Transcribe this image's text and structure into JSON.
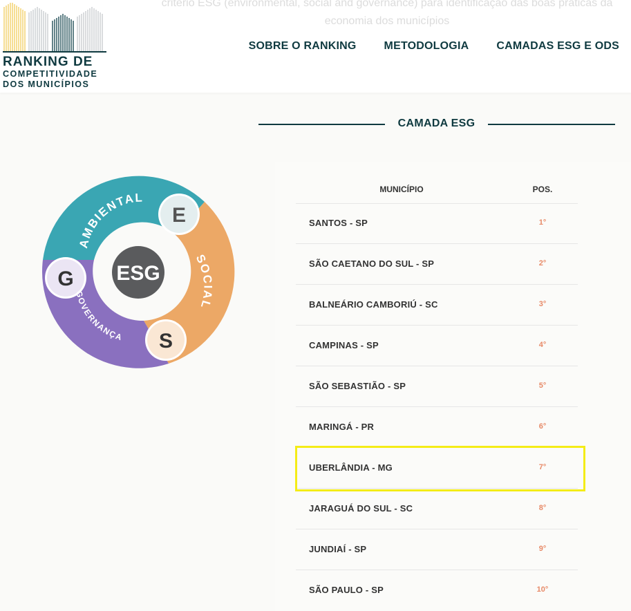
{
  "header": {
    "faded_text_line1": "critério ESG (environmental, social and governance) para identificação das boas práticas da",
    "faded_text_line2": "economia dos municípios",
    "logo": {
      "line1": "RANKING DE",
      "line2": "COMPETITIVIDADE",
      "line3": "DOS MUNICÍPIOS",
      "colors": {
        "yellow": "#f2cf66",
        "grey": "#c9cdcf",
        "teal": "#1f4d55",
        "dark": "#0f3a40"
      }
    },
    "nav": [
      {
        "label": "SOBRE O RANKING"
      },
      {
        "label": "METODOLOGIA"
      },
      {
        "label": "CAMADAS ESG E ODS"
      }
    ]
  },
  "section": {
    "title": "CAMADA ESG"
  },
  "esg_wheel": {
    "center": "ESG",
    "segments": [
      {
        "letter": "E",
        "label": "AMBIENTAL",
        "color": "#3aa6b3"
      },
      {
        "letter": "S",
        "label": "SOCIAL",
        "color": "#eca866"
      },
      {
        "letter": "G",
        "label": "GOVERNANÇA",
        "color": "#8a70bf"
      }
    ]
  },
  "table": {
    "headers": {
      "municipio": "MUNICÍPIO",
      "pos": "POS."
    },
    "rows": [
      {
        "name": "SANTOS - SP",
        "pos": "1°"
      },
      {
        "name": "SÃO CAETANO DO SUL - SP",
        "pos": "2°"
      },
      {
        "name": "BALNEÁRIO CAMBORIÚ - SC",
        "pos": "3°"
      },
      {
        "name": "CAMPINAS - SP",
        "pos": "4°"
      },
      {
        "name": "SÃO SEBASTIÃO - SP",
        "pos": "5°"
      },
      {
        "name": "MARINGÁ - PR",
        "pos": "6°"
      },
      {
        "name": "UBERLÂNDIA - MG",
        "pos": "7°"
      },
      {
        "name": "JARAGUÁ DO SUL - SC",
        "pos": "8°"
      },
      {
        "name": "JUNDIAÍ - SP",
        "pos": "9°"
      },
      {
        "name": "SÃO PAULO - SP",
        "pos": "10°"
      }
    ],
    "highlighted_row": 6,
    "highlight_color": "#f4ec17",
    "pos_color": "#e78a68"
  }
}
